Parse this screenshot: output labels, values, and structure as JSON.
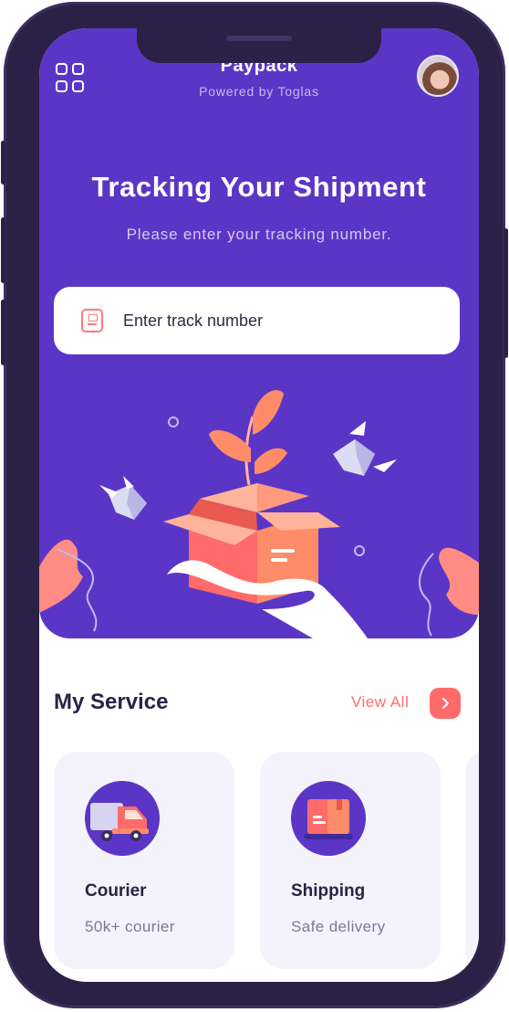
{
  "app": {
    "title": "Paypack",
    "subtitle": "Powered by Toglas"
  },
  "hero": {
    "title": "Tracking Your Shipment",
    "subtitle": "Please enter your tracking number.",
    "search_placeholder": "Enter track number"
  },
  "services": {
    "heading": "My Service",
    "view_all_label": "View All",
    "items": [
      {
        "title": "Courier",
        "subtitle": "50k+ courier",
        "icon": "truck-icon"
      },
      {
        "title": "Shipping",
        "subtitle": "Safe delivery",
        "icon": "package-icon"
      }
    ]
  },
  "colors": {
    "primary": "#5b36c6",
    "accent": "#ff6b6b",
    "card_bg": "#f4f2fb",
    "text_dark": "#2b2345",
    "device_frame": "#2b2146"
  }
}
